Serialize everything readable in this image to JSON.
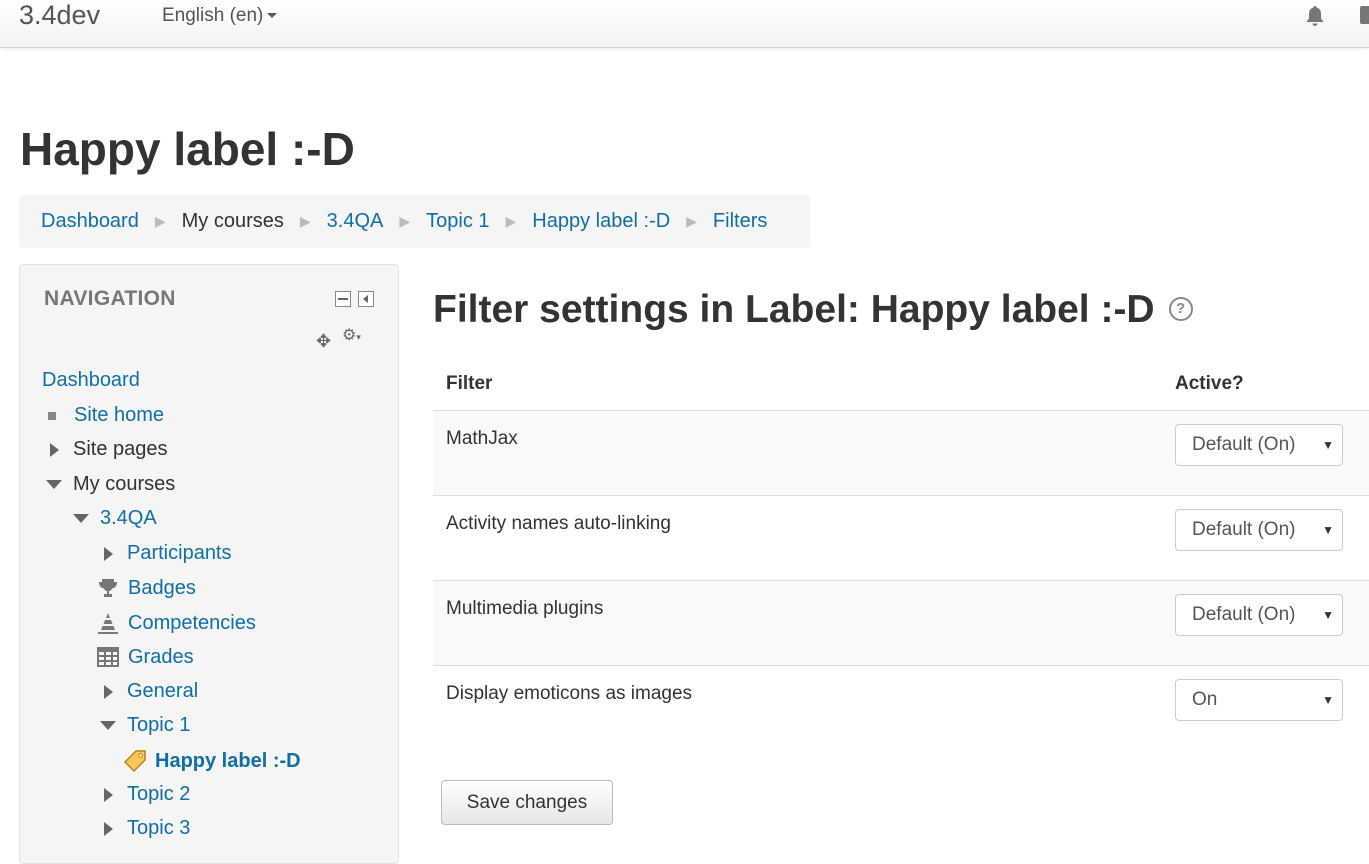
{
  "navbar": {
    "brand": "3.4dev",
    "language": "English (en)"
  },
  "page": {
    "header": "Happy label :-D"
  },
  "breadcrumb": [
    {
      "label": "Dashboard",
      "link": true
    },
    {
      "label": "My courses",
      "link": false
    },
    {
      "label": "3.4QA",
      "link": true
    },
    {
      "label": "Topic 1",
      "link": true
    },
    {
      "label": "Happy label :-D",
      "link": true
    },
    {
      "label": "Filters",
      "link": true
    }
  ],
  "navigation": {
    "title": "NAVIGATION",
    "items": [
      {
        "label": "Dashboard"
      },
      {
        "label": "Site home"
      },
      {
        "label": "Site pages"
      },
      {
        "label": "My courses"
      },
      {
        "label": "3.4QA"
      },
      {
        "label": "Participants"
      },
      {
        "label": "Badges"
      },
      {
        "label": "Competencies"
      },
      {
        "label": "Grades"
      },
      {
        "label": "General"
      },
      {
        "label": "Topic 1"
      },
      {
        "label": "Happy label :-D"
      },
      {
        "label": "Topic 2"
      },
      {
        "label": "Topic 3"
      }
    ]
  },
  "main": {
    "title": "Filter settings in Label: Happy label :-D",
    "col_filter": "Filter",
    "col_active": "Active?",
    "filters": [
      {
        "name": "MathJax",
        "value": "Default (On)"
      },
      {
        "name": "Activity names auto-linking",
        "value": "Default (On)"
      },
      {
        "name": "Multimedia plugins",
        "value": "Default (On)"
      },
      {
        "name": "Display emoticons as images",
        "value": "On"
      }
    ],
    "save_label": "Save changes"
  }
}
